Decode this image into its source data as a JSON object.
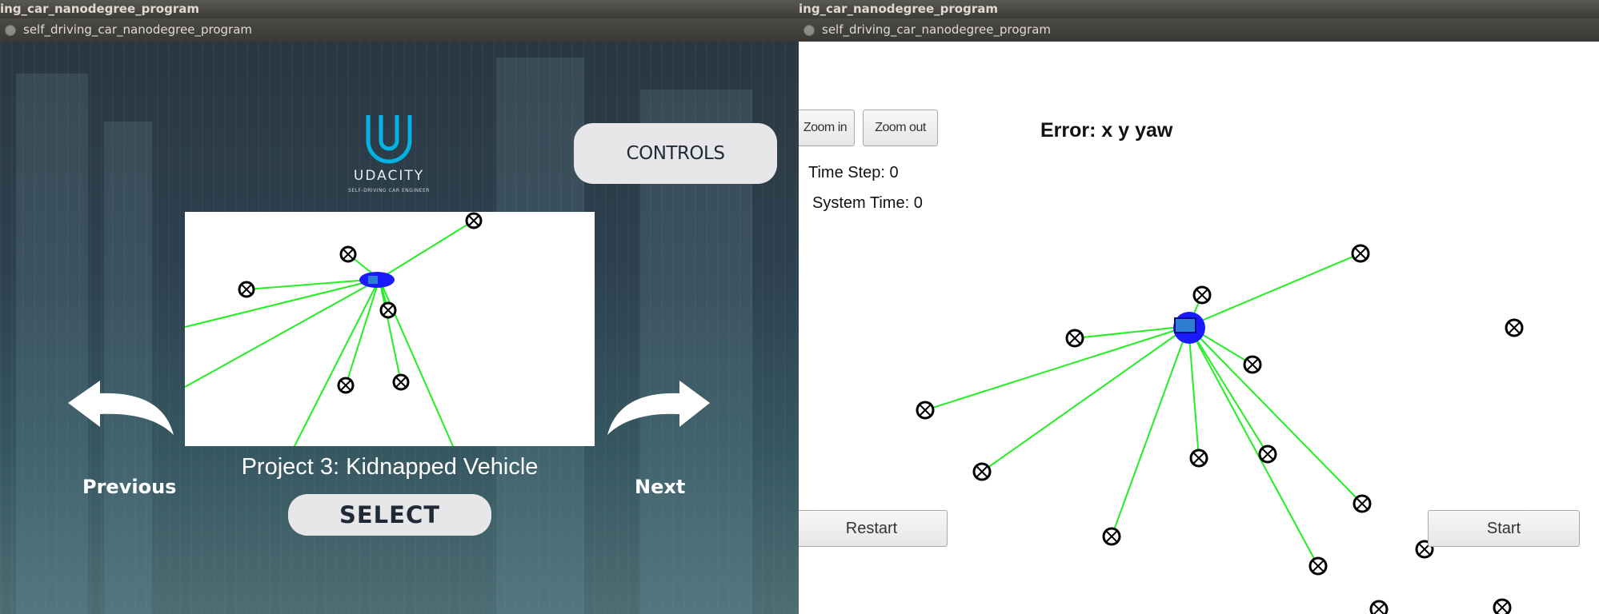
{
  "left": {
    "topbar_title": "ing_car_nanodegree_program",
    "window_title": "self_driving_car_nanodegree_program",
    "logo_text": "UDACITY",
    "logo_subtext": "SELF-DRIVING CAR ENGINEER",
    "controls_label": "CONTROLS",
    "prev_label": "Previous",
    "next_label": "Next",
    "project_title": "Project 3: Kidnapped Vehicle",
    "select_label": "SELECT"
  },
  "right": {
    "topbar_title": "ing_car_nanodegree_program",
    "window_title": "self_driving_car_nanodegree_program",
    "zoom_in_label": "Zoom in",
    "zoom_out_label": "Zoom out",
    "error_label": "Error: x y yaw",
    "time_step_label": "Time Step: 0",
    "system_time_label": "System Time: 0",
    "restart_label": "Restart",
    "start_label": "Start"
  },
  "colors": {
    "laser": "#22ee22",
    "car": "#1a1aff",
    "landmark": "#000000",
    "udacity_blue": "#02b3e4"
  }
}
